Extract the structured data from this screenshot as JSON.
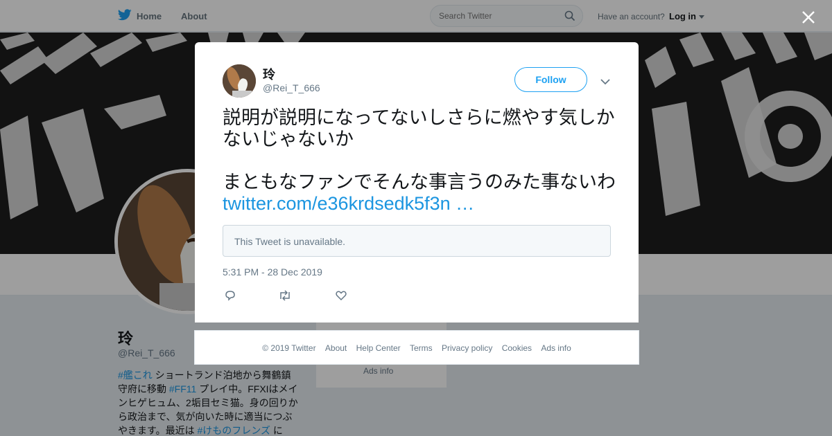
{
  "colors": {
    "accent": "#1da1f2",
    "link": "#1b95e0",
    "text": "#14171a",
    "muted": "#657786"
  },
  "nav": {
    "home": "Home",
    "about": "About",
    "search_placeholder": "Search Twitter",
    "have_account": "Have an account?",
    "login": "Log in"
  },
  "profile": {
    "name": "玲",
    "handle": "@Rei_T_666",
    "bio": {
      "tag1": "#艦これ",
      "text1": " ショートランド泊地から舞鶴鎮守府に移動 ",
      "tag2": "#FF11",
      "text2": " プレイ中。FFXIはメインヒゲヒュム、2垢目セミ猫。身の回りから政治まで、気が向いた時に適当につぶやきます。最近は ",
      "tag3": "#けものフレンズ",
      "text3": " に"
    },
    "side_ads": "Ads info"
  },
  "tweet": {
    "author_name": "玲",
    "author_handle": "@Rei_T_666",
    "follow_label": "Follow",
    "line1": "説明が説明になってないしさらに燃やす気しかないじゃないか",
    "line2": "まともなファンでそんな事言うのみた事ないわ ",
    "link": "twitter.com/e36krdsedk5f3n …",
    "quote_unavailable": "This Tweet is unavailable.",
    "timestamp": "5:31 PM - 28 Dec 2019"
  },
  "footer": {
    "links": [
      "© 2019 Twitter",
      "About",
      "Help Center",
      "Terms",
      "Privacy policy",
      "Cookies",
      "Ads info"
    ]
  }
}
